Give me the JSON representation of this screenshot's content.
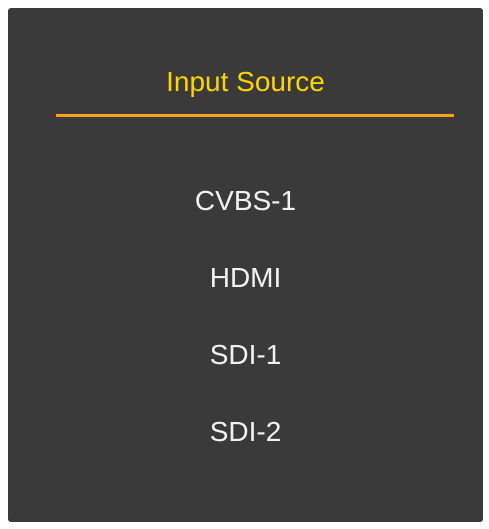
{
  "menu": {
    "title": "Input Source",
    "items": [
      {
        "label": "CVBS-1"
      },
      {
        "label": "HDMI"
      },
      {
        "label": "SDI-1"
      },
      {
        "label": "SDI-2"
      }
    ]
  },
  "colors": {
    "panel_background": "#3a3a3a",
    "title_text": "#ffd400",
    "underline": "#ff9f1a",
    "item_text": "#f2f2f2"
  }
}
